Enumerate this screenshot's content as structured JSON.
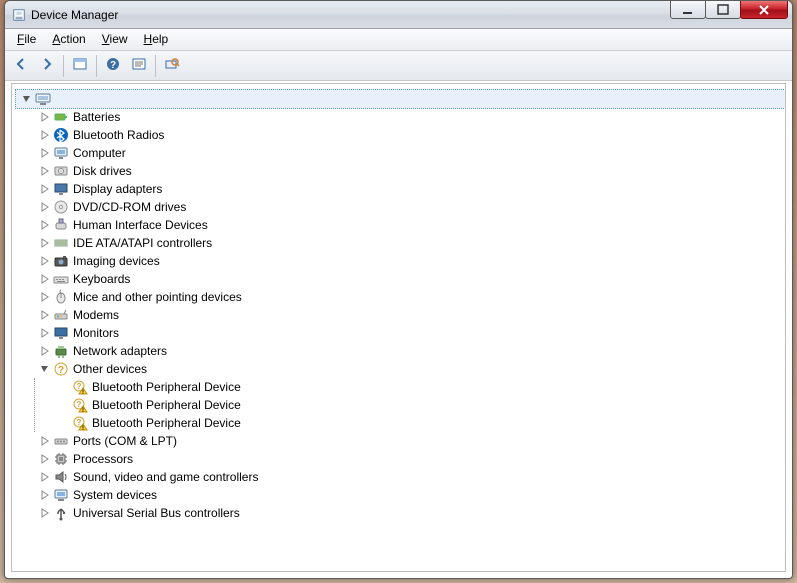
{
  "window": {
    "title": "Device Manager"
  },
  "menu": {
    "file": {
      "label": "File",
      "mn": "F"
    },
    "action": {
      "label": "Action",
      "mn": "A"
    },
    "view": {
      "label": "View",
      "mn": "V"
    },
    "help": {
      "label": "Help",
      "mn": "H"
    }
  },
  "toolbar": {
    "back": "Back",
    "forward": "Forward",
    "properties": "Properties",
    "help": "Help",
    "show_hidden": "Show hidden devices",
    "scan": "Scan for hardware changes"
  },
  "tree": {
    "root": {
      "label": "",
      "expanded": true,
      "selected": true
    },
    "categories": [
      {
        "id": "batteries",
        "label": "Batteries",
        "icon": "battery-icon"
      },
      {
        "id": "bt-radios",
        "label": "Bluetooth Radios",
        "icon": "bluetooth-icon"
      },
      {
        "id": "computer",
        "label": "Computer",
        "icon": "computer-icon"
      },
      {
        "id": "disk",
        "label": "Disk drives",
        "icon": "disk-icon"
      },
      {
        "id": "display",
        "label": "Display adapters",
        "icon": "display-icon"
      },
      {
        "id": "dvd",
        "label": "DVD/CD-ROM drives",
        "icon": "cdrom-icon"
      },
      {
        "id": "hid",
        "label": "Human Interface Devices",
        "icon": "hid-icon"
      },
      {
        "id": "ide",
        "label": "IDE ATA/ATAPI controllers",
        "icon": "ide-icon"
      },
      {
        "id": "imaging",
        "label": "Imaging devices",
        "icon": "imaging-icon"
      },
      {
        "id": "keyboards",
        "label": "Keyboards",
        "icon": "keyboard-icon"
      },
      {
        "id": "mice",
        "label": "Mice and other pointing devices",
        "icon": "mouse-icon"
      },
      {
        "id": "modems",
        "label": "Modems",
        "icon": "modem-icon"
      },
      {
        "id": "monitors",
        "label": "Monitors",
        "icon": "monitor-icon"
      },
      {
        "id": "network",
        "label": "Network adapters",
        "icon": "network-icon"
      },
      {
        "id": "other",
        "label": "Other devices",
        "icon": "unknown-icon",
        "expanded": true,
        "children": [
          {
            "label": "Bluetooth Peripheral Device",
            "icon": "unknown-warn-icon"
          },
          {
            "label": "Bluetooth Peripheral Device",
            "icon": "unknown-warn-icon"
          },
          {
            "label": "Bluetooth Peripheral Device",
            "icon": "unknown-warn-icon"
          }
        ]
      },
      {
        "id": "ports",
        "label": "Ports (COM & LPT)",
        "icon": "port-icon"
      },
      {
        "id": "processors",
        "label": "Processors",
        "icon": "cpu-icon"
      },
      {
        "id": "sound",
        "label": "Sound, video and game controllers",
        "icon": "sound-icon"
      },
      {
        "id": "system",
        "label": "System devices",
        "icon": "system-icon"
      },
      {
        "id": "usb",
        "label": "Universal Serial Bus controllers",
        "icon": "usb-icon"
      }
    ]
  }
}
